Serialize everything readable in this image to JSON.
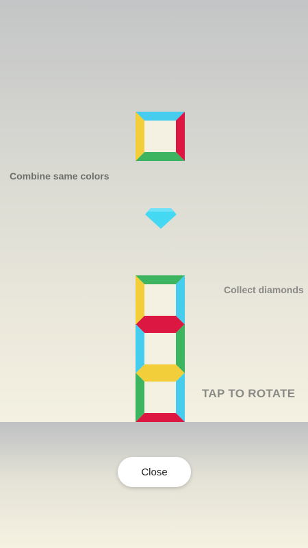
{
  "colors": {
    "yellow": "#f2cf3a",
    "red": "#dc1842",
    "green": "#3cb460",
    "cyan": "#46cdee",
    "inner": "#f5f1e2",
    "diamond": "#45d8f2"
  },
  "tutorial": {
    "combine_hint": "Combine same colors",
    "collect_hint": "Collect diamonds",
    "rotate_hint": "TAP TO ROTATE"
  },
  "falling_block": {
    "top": "cyan",
    "right": "red",
    "bottom": "green",
    "left": "yellow"
  },
  "stack": [
    {
      "top": "green",
      "right": "cyan",
      "bottom": "red",
      "left": "yellow"
    },
    {
      "top": "red",
      "right": "green",
      "bottom": "yellow",
      "left": "cyan"
    },
    {
      "top": "yellow",
      "right": "cyan",
      "bottom": "red",
      "left": "green"
    }
  ],
  "controls": {
    "close_label": "Close"
  }
}
